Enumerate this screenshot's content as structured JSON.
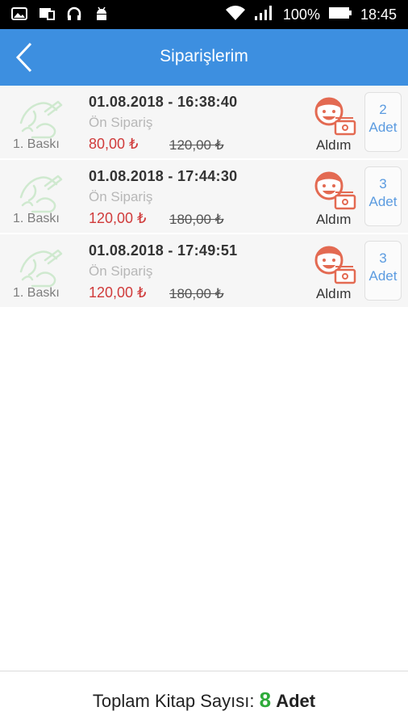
{
  "status_bar": {
    "battery_percent": "100%",
    "time": "18:45",
    "icons": [
      "image-icon",
      "cast-icon",
      "headset-icon",
      "android-icon",
      "wifi-icon",
      "signal-icon",
      "battery-icon"
    ]
  },
  "header": {
    "title": "Siparişlerim",
    "back_icon": "chevron-left-icon",
    "color": "#3d8fe0"
  },
  "orders": [
    {
      "edition": "1. Baskı",
      "datetime": "01.08.2018  -  16:38:40",
      "status": "Ön Sipariş",
      "price": "80,00 ₺",
      "old_price": "120,00 ₺",
      "action": "Aldım",
      "qty_num": "2",
      "qty_unit": "Adet"
    },
    {
      "edition": "1. Baskı",
      "datetime": "01.08.2018  -  17:44:30",
      "status": "Ön Sipariş",
      "price": "120,00 ₺",
      "old_price": "180,00 ₺",
      "action": "Aldım",
      "qty_num": "3",
      "qty_unit": "Adet"
    },
    {
      "edition": "1. Baskı",
      "datetime": "01.08.2018  -  17:49:51",
      "status": "Ön Sipariş",
      "price": "120,00 ₺",
      "old_price": "180,00 ₺",
      "action": "Aldım",
      "qty_num": "3",
      "qty_unit": "Adet"
    }
  ],
  "footer": {
    "label": "Toplam Kitap Sayısı:",
    "count": "8",
    "unit": "Adet",
    "count_color": "#2eab3a"
  }
}
